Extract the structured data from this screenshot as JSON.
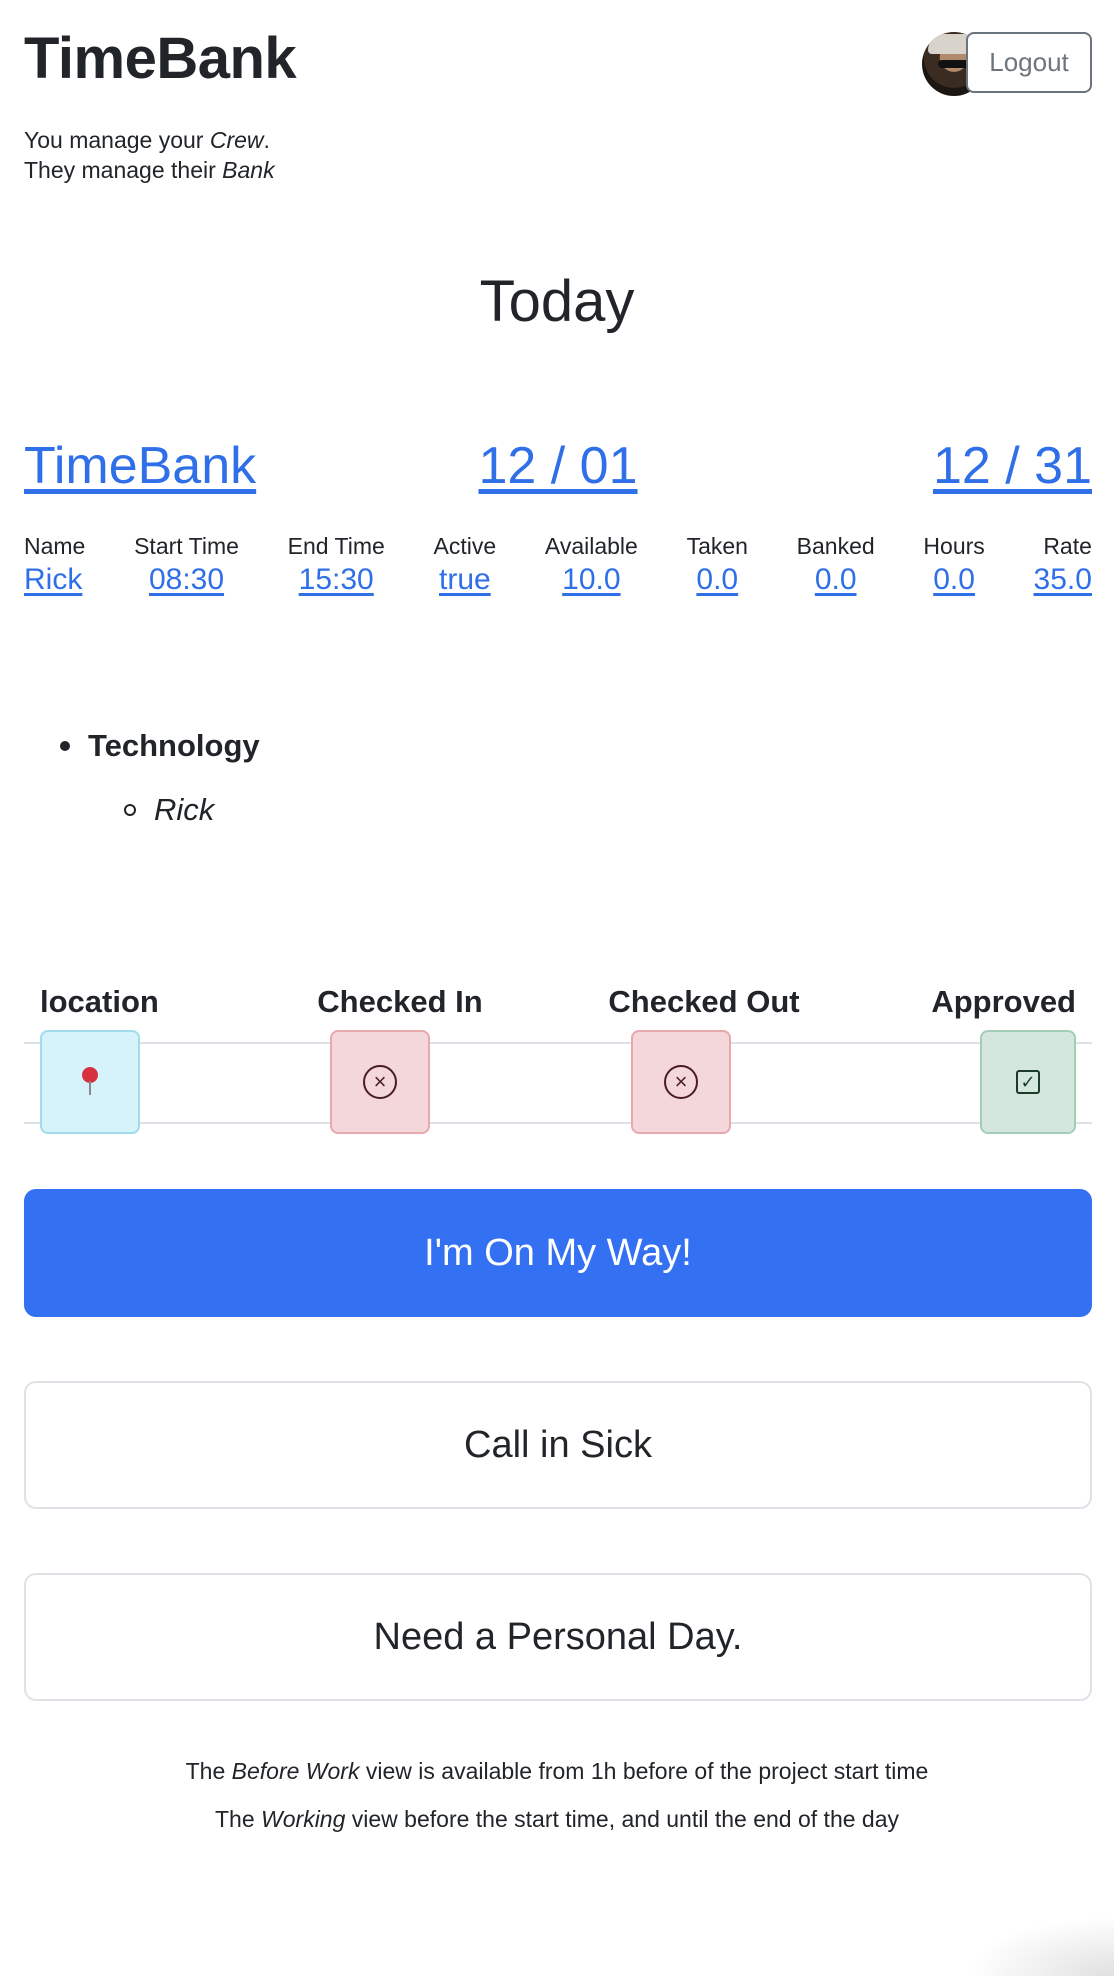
{
  "header": {
    "brand": "TimeBank",
    "tagline_line1_pre": "You manage your ",
    "tagline_line1_em": "Crew",
    "tagline_line1_post": ".",
    "tagline_line2_pre": "They manage their ",
    "tagline_line2_em": "Bank",
    "logout_label": "Logout"
  },
  "page_title": "Today",
  "period": {
    "brand_link": "TimeBank",
    "start": "12 / 01",
    "end": "12 / 31"
  },
  "stats": [
    {
      "label": "Name",
      "value": "Rick"
    },
    {
      "label": "Start Time",
      "value": "08:30"
    },
    {
      "label": "End Time",
      "value": "15:30"
    },
    {
      "label": "Active",
      "value": "true"
    },
    {
      "label": "Available",
      "value": "10.0"
    },
    {
      "label": "Taken",
      "value": "0.0"
    },
    {
      "label": "Banked",
      "value": "0.0"
    },
    {
      "label": "Hours",
      "value": "0.0"
    },
    {
      "label": "Rate",
      "value": "35.0"
    }
  ],
  "teams": [
    {
      "name": "Technology",
      "members": [
        "Rick"
      ]
    }
  ],
  "status": {
    "headers": [
      "location",
      "Checked In",
      "Checked Out",
      "Approved"
    ],
    "icons": [
      "map-pin-icon",
      "x-circle-icon",
      "x-circle-icon",
      "check-square-icon"
    ],
    "checked_in": false,
    "checked_out": false,
    "approved": true
  },
  "actions": {
    "on_my_way": "I'm On My Way!",
    "call_in_sick": "Call in Sick",
    "personal_day": "Need a Personal Day."
  },
  "notes": {
    "line1_pre": "The ",
    "line1_em": "Before Work",
    "line1_post": " view is available from 1h before of the project start time",
    "line2_pre": "The ",
    "line2_em": "Working",
    "line2_post": " view before the start time, and until the end of the day"
  },
  "colors": {
    "link": "#2f6fe8",
    "primary": "#3370f2",
    "info_bg": "#d6f3fb",
    "danger_bg": "#f4d7da",
    "success_bg": "#d3e7dd"
  }
}
